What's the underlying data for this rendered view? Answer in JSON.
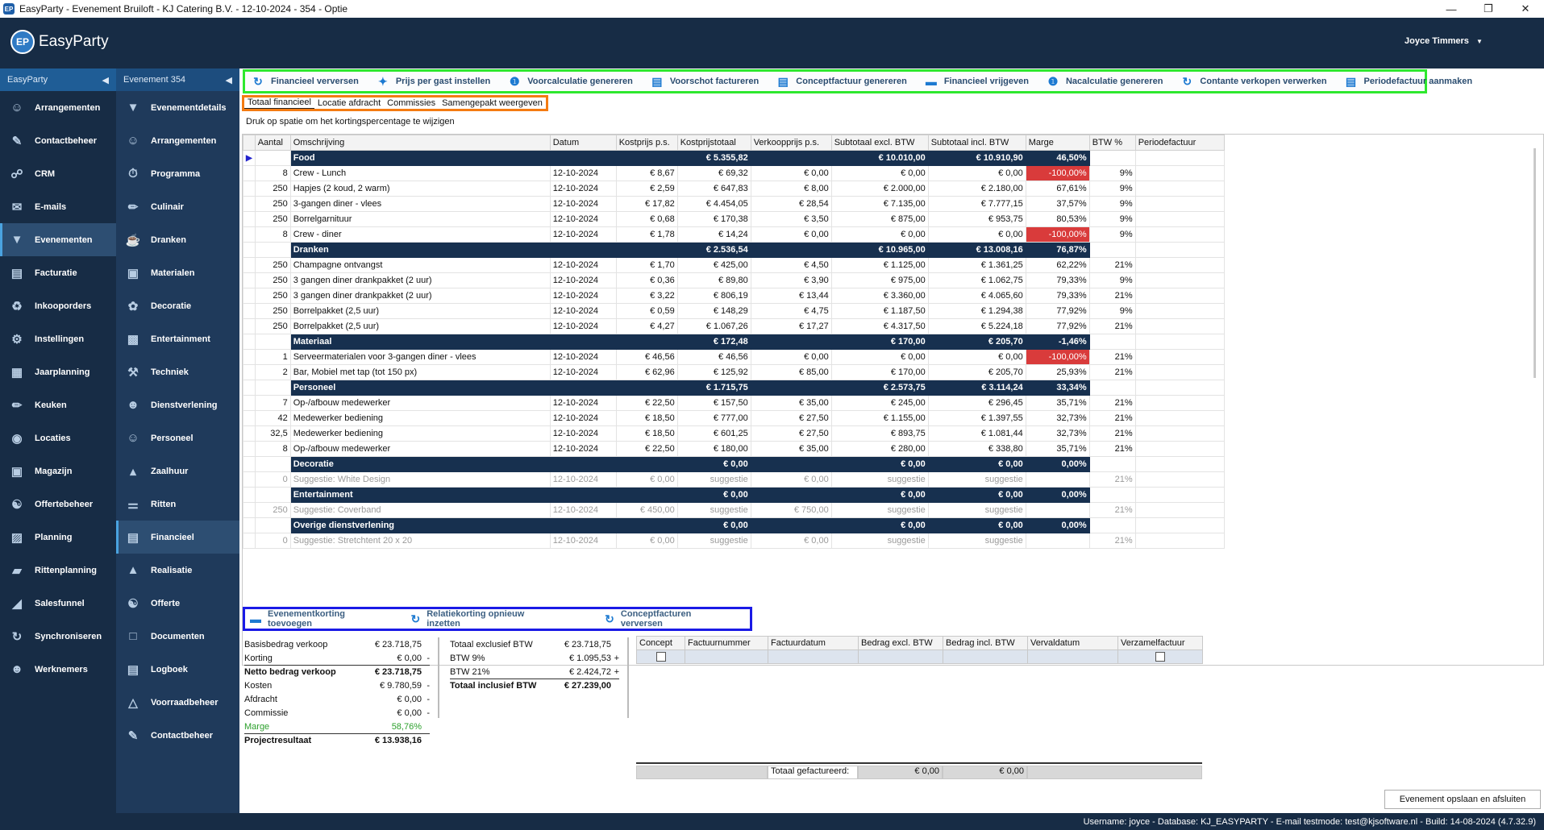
{
  "window": {
    "title": "EasyParty - Evenement Bruiloft - KJ Catering B.V. - 12-10-2024 - 354 - Optie",
    "logo_text": "EP"
  },
  "app": {
    "name": "EasyParty",
    "user": "Joyce Timmers"
  },
  "sidebar": {
    "header": "EasyParty",
    "items": [
      {
        "label": "Arrangementen",
        "icon": "people-icon"
      },
      {
        "label": "Contactbeheer",
        "icon": "contact-card-icon"
      },
      {
        "label": "CRM",
        "icon": "crm-icon"
      },
      {
        "label": "E-mails",
        "icon": "mail-icon"
      },
      {
        "label": "Evenementen",
        "icon": "cocktail-icon"
      },
      {
        "label": "Facturatie",
        "icon": "invoice-icon"
      },
      {
        "label": "Inkooporders",
        "icon": "cart-icon"
      },
      {
        "label": "Instellingen",
        "icon": "gear-icon"
      },
      {
        "label": "Jaarplanning",
        "icon": "calendar-icon"
      },
      {
        "label": "Keuken",
        "icon": "knife-icon"
      },
      {
        "label": "Locaties",
        "icon": "location-icon"
      },
      {
        "label": "Magazijn",
        "icon": "box-icon"
      },
      {
        "label": "Offertebeheer",
        "icon": "handshake-icon"
      },
      {
        "label": "Planning",
        "icon": "planning-icon"
      },
      {
        "label": "Rittenplanning",
        "icon": "truck-icon"
      },
      {
        "label": "Salesfunnel",
        "icon": "funnel-icon"
      },
      {
        "label": "Synchroniseren",
        "icon": "sync-icon"
      },
      {
        "label": "Werknemers",
        "icon": "employees-icon"
      }
    ]
  },
  "sidebar2": {
    "header": "Evenement 354",
    "items": [
      {
        "label": "Evenementdetails",
        "icon": "cocktail-icon"
      },
      {
        "label": "Arrangementen",
        "icon": "people-icon"
      },
      {
        "label": "Programma",
        "icon": "stopwatch-icon"
      },
      {
        "label": "Culinair",
        "icon": "knife-icon"
      },
      {
        "label": "Dranken",
        "icon": "glasses-icon"
      },
      {
        "label": "Materialen",
        "icon": "box-icon"
      },
      {
        "label": "Decoratie",
        "icon": "flower-icon"
      },
      {
        "label": "Entertainment",
        "icon": "speaker-icon"
      },
      {
        "label": "Techniek",
        "icon": "wrench-icon"
      },
      {
        "label": "Dienstverlening",
        "icon": "waiter-icon"
      },
      {
        "label": "Personeel",
        "icon": "staff-icon"
      },
      {
        "label": "Zaalhuur",
        "icon": "venue-icon"
      },
      {
        "label": "Ritten",
        "icon": "road-icon"
      },
      {
        "label": "Financieel",
        "icon": "finance-icon"
      },
      {
        "label": "Realisatie",
        "icon": "chart-icon"
      },
      {
        "label": "Offerte",
        "icon": "handshake-icon"
      },
      {
        "label": "Documenten",
        "icon": "folder-icon"
      },
      {
        "label": "Logboek",
        "icon": "logbook-icon"
      },
      {
        "label": "Voorraadbeheer",
        "icon": "stock-icon"
      },
      {
        "label": "Contactbeheer",
        "icon": "contact-card-icon"
      }
    ]
  },
  "toolbar": [
    {
      "label": "Financieel verversen",
      "icon": "refresh-icon"
    },
    {
      "label": "Prijs per gast instellen",
      "icon": "share-icon"
    },
    {
      "label": "Voorcalculatie genereren",
      "icon": "number-one-icon"
    },
    {
      "label": "Voorschot factureren",
      "icon": "invoice-icon"
    },
    {
      "label": "Conceptfactuur genereren",
      "icon": "concept-invoice-icon"
    },
    {
      "label": "Financieel vrijgeven",
      "icon": "money-icon"
    },
    {
      "label": "Nacalculatie genereren",
      "icon": "number-one-icon"
    },
    {
      "label": "Contante verkopen verwerken",
      "icon": "cash-sync-icon"
    },
    {
      "label": "Periodefactuur aanmaken",
      "icon": "invoice-icon"
    }
  ],
  "tabs": [
    "Totaal financieel",
    "Locatie afdracht",
    "Commissies",
    "Samengepakt weergeven"
  ],
  "hint": "Druk op spatie om het kortingspercentage te wijzigen",
  "columns": [
    "Aantal",
    "Omschrijving",
    "Datum",
    "Kostprijs p.s.",
    "Kostprijstotaal",
    "Verkoopprijs p.s.",
    "Subtotaal excl. BTW",
    "Subtotaal incl. BTW",
    "Marge",
    "BTW %",
    "Periodefactuur"
  ],
  "rows": [
    {
      "t": "g",
      "c": [
        "",
        "Food",
        "",
        "",
        "€ 5.355,82",
        "",
        "€ 10.010,00",
        "€ 10.910,90",
        "46,50%",
        "",
        ""
      ]
    },
    {
      "t": "r",
      "c": [
        "8",
        "Crew - Lunch",
        "12-10-2024",
        "€ 8,67",
        "€ 69,32",
        "€ 0,00",
        "€ 0,00",
        "€ 0,00",
        "-100,00%",
        "9%",
        ""
      ]
    },
    {
      "t": "r",
      "c": [
        "250",
        "Hapjes (2 koud, 2 warm)",
        "12-10-2024",
        "€ 2,59",
        "€ 647,83",
        "€ 8,00",
        "€ 2.000,00",
        "€ 2.180,00",
        "67,61%",
        "9%",
        ""
      ]
    },
    {
      "t": "r",
      "c": [
        "250",
        "3-gangen diner - vlees",
        "12-10-2024",
        "€ 17,82",
        "€ 4.454,05",
        "€ 28,54",
        "€ 7.135,00",
        "€ 7.777,15",
        "37,57%",
        "9%",
        ""
      ]
    },
    {
      "t": "r",
      "c": [
        "250",
        "Borrelgarnituur",
        "12-10-2024",
        "€ 0,68",
        "€ 170,38",
        "€ 3,50",
        "€ 875,00",
        "€ 953,75",
        "80,53%",
        "9%",
        ""
      ]
    },
    {
      "t": "r",
      "c": [
        "8",
        "Crew - diner",
        "12-10-2024",
        "€ 1,78",
        "€ 14,24",
        "€ 0,00",
        "€ 0,00",
        "€ 0,00",
        "-100,00%",
        "9%",
        ""
      ]
    },
    {
      "t": "g",
      "c": [
        "",
        "Dranken",
        "",
        "",
        "€ 2.536,54",
        "",
        "€ 10.965,00",
        "€ 13.008,16",
        "76,87%",
        "",
        ""
      ]
    },
    {
      "t": "r",
      "c": [
        "250",
        "Champagne ontvangst",
        "12-10-2024",
        "€ 1,70",
        "€ 425,00",
        "€ 4,50",
        "€ 1.125,00",
        "€ 1.361,25",
        "62,22%",
        "21%",
        ""
      ]
    },
    {
      "t": "r",
      "c": [
        "250",
        "3 gangen diner drankpakket (2 uur)",
        "12-10-2024",
        "€ 0,36",
        "€ 89,80",
        "€ 3,90",
        "€ 975,00",
        "€ 1.062,75",
        "79,33%",
        "9%",
        ""
      ]
    },
    {
      "t": "r",
      "c": [
        "250",
        "3 gangen diner drankpakket (2 uur)",
        "12-10-2024",
        "€ 3,22",
        "€ 806,19",
        "€ 13,44",
        "€ 3.360,00",
        "€ 4.065,60",
        "79,33%",
        "21%",
        ""
      ]
    },
    {
      "t": "r",
      "c": [
        "250",
        "Borrelpakket (2,5 uur)",
        "12-10-2024",
        "€ 0,59",
        "€ 148,29",
        "€ 4,75",
        "€ 1.187,50",
        "€ 1.294,38",
        "77,92%",
        "9%",
        ""
      ]
    },
    {
      "t": "r",
      "c": [
        "250",
        "Borrelpakket (2,5 uur)",
        "12-10-2024",
        "€ 4,27",
        "€ 1.067,26",
        "€ 17,27",
        "€ 4.317,50",
        "€ 5.224,18",
        "77,92%",
        "21%",
        ""
      ]
    },
    {
      "t": "g",
      "c": [
        "",
        "Materiaal",
        "",
        "",
        "€ 172,48",
        "",
        "€ 170,00",
        "€ 205,70",
        "-1,46%",
        "",
        ""
      ]
    },
    {
      "t": "r",
      "c": [
        "1",
        "Serveermaterialen voor 3-gangen diner - vlees",
        "12-10-2024",
        "€ 46,56",
        "€ 46,56",
        "€ 0,00",
        "€ 0,00",
        "€ 0,00",
        "-100,00%",
        "21%",
        ""
      ]
    },
    {
      "t": "r",
      "c": [
        "2",
        "Bar, Mobiel met tap (tot 150 px)",
        "12-10-2024",
        "€ 62,96",
        "€ 125,92",
        "€ 85,00",
        "€ 170,00",
        "€ 205,70",
        "25,93%",
        "21%",
        ""
      ]
    },
    {
      "t": "g",
      "c": [
        "",
        "Personeel",
        "",
        "",
        "€ 1.715,75",
        "",
        "€ 2.573,75",
        "€ 3.114,24",
        "33,34%",
        "",
        ""
      ]
    },
    {
      "t": "r",
      "c": [
        "7",
        "Op-/afbouw medewerker",
        "12-10-2024",
        "€ 22,50",
        "€ 157,50",
        "€ 35,00",
        "€ 245,00",
        "€ 296,45",
        "35,71%",
        "21%",
        ""
      ]
    },
    {
      "t": "r",
      "c": [
        "42",
        "Medewerker bediening",
        "12-10-2024",
        "€ 18,50",
        "€ 777,00",
        "€ 27,50",
        "€ 1.155,00",
        "€ 1.397,55",
        "32,73%",
        "21%",
        ""
      ]
    },
    {
      "t": "r",
      "c": [
        "32,5",
        "Medewerker bediening",
        "12-10-2024",
        "€ 18,50",
        "€ 601,25",
        "€ 27,50",
        "€ 893,75",
        "€ 1.081,44",
        "32,73%",
        "21%",
        ""
      ]
    },
    {
      "t": "r",
      "c": [
        "8",
        "Op-/afbouw medewerker",
        "12-10-2024",
        "€ 22,50",
        "€ 180,00",
        "€ 35,00",
        "€ 280,00",
        "€ 338,80",
        "35,71%",
        "21%",
        ""
      ]
    },
    {
      "t": "g",
      "c": [
        "",
        "Decoratie",
        "",
        "",
        "€ 0,00",
        "",
        "€ 0,00",
        "€ 0,00",
        "0,00%",
        "",
        ""
      ]
    },
    {
      "t": "s",
      "c": [
        "0",
        "Suggestie: White Design",
        "12-10-2024",
        "€ 0,00",
        "suggestie",
        "€ 0,00",
        "suggestie",
        "suggestie",
        "",
        "21%",
        ""
      ]
    },
    {
      "t": "g",
      "c": [
        "",
        "Entertainment",
        "",
        "",
        "€ 0,00",
        "",
        "€ 0,00",
        "€ 0,00",
        "0,00%",
        "",
        ""
      ]
    },
    {
      "t": "s",
      "c": [
        "250",
        "Suggestie: Coverband",
        "12-10-2024",
        "€ 450,00",
        "suggestie",
        "€ 750,00",
        "suggestie",
        "suggestie",
        "",
        "21%",
        ""
      ]
    },
    {
      "t": "g",
      "c": [
        "",
        "Overige dienstverlening",
        "",
        "",
        "€ 0,00",
        "",
        "€ 0,00",
        "€ 0,00",
        "0,00%",
        "",
        ""
      ]
    },
    {
      "t": "s",
      "c": [
        "0",
        "Suggestie: Stretchtent 20 x 20",
        "12-10-2024",
        "€ 0,00",
        "suggestie",
        "€ 0,00",
        "suggestie",
        "suggestie",
        "",
        "21%",
        ""
      ]
    }
  ],
  "actions": [
    {
      "label": "Evenementkorting toevoegen",
      "icon": "money-icon"
    },
    {
      "label": "Relatiekorting opnieuw inzetten",
      "icon": "refresh-icon"
    },
    {
      "label": "Conceptfacturen verversen",
      "icon": "refresh-icon"
    }
  ],
  "summary1": [
    {
      "label": "Basisbedrag verkoop",
      "value": "€ 23.718,75",
      "sign": ""
    },
    {
      "label": "Korting",
      "value": "€ 0,00",
      "sign": "-"
    },
    {
      "label": "Netto bedrag verkoop",
      "value": "€ 23.718,75",
      "sign": "",
      "bold": true,
      "line": true
    },
    {
      "label": "Kosten",
      "value": "€ 9.780,59",
      "sign": "-"
    },
    {
      "label": "Afdracht",
      "value": "€ 0,00",
      "sign": "-"
    },
    {
      "label": "Commissie",
      "value": "€ 0,00",
      "sign": "-"
    },
    {
      "label": "Marge",
      "value": "58,76%",
      "sign": "",
      "green": true
    },
    {
      "label": "Projectresultaat",
      "value": "€ 13.938,16",
      "sign": "",
      "bold": true,
      "line": true
    }
  ],
  "summary2": [
    {
      "label": "Totaal exclusief BTW",
      "value": "€ 23.718,75",
      "sign": ""
    },
    {
      "label": "BTW 9%",
      "value": "€ 1.095,53",
      "sign": "+"
    },
    {
      "label": "BTW 21%",
      "value": "€ 2.424,72",
      "sign": "+"
    },
    {
      "label": "Totaal inclusief BTW",
      "value": "€ 27.239,00",
      "sign": "",
      "bold": true,
      "line": true
    }
  ],
  "invoices": {
    "columns": [
      "Concept",
      "Factuurnummer",
      "Factuurdatum",
      "Bedrag excl. BTW",
      "Bedrag incl. BTW",
      "Vervaldatum",
      "Verzamelfactuur"
    ],
    "total_label": "Totaal gefactureerd:",
    "total_excl": "€ 0,00",
    "total_incl": "€ 0,00"
  },
  "save_button": "Evenement opslaan en afsluiten",
  "status": "Username: joyce - Database: KJ_EASYPARTY - E-mail testmode: test@kjsoftware.nl - Build: 14-08-2024 (4.7.32.9)",
  "colors": {
    "nav_bg": "#172c45",
    "group_row": "#17304f",
    "negative_margin": "#d93b3b",
    "toolbar_border": "#2ee82e",
    "tabs_border": "#f47b11",
    "actions_border": "#1a1ae6"
  }
}
